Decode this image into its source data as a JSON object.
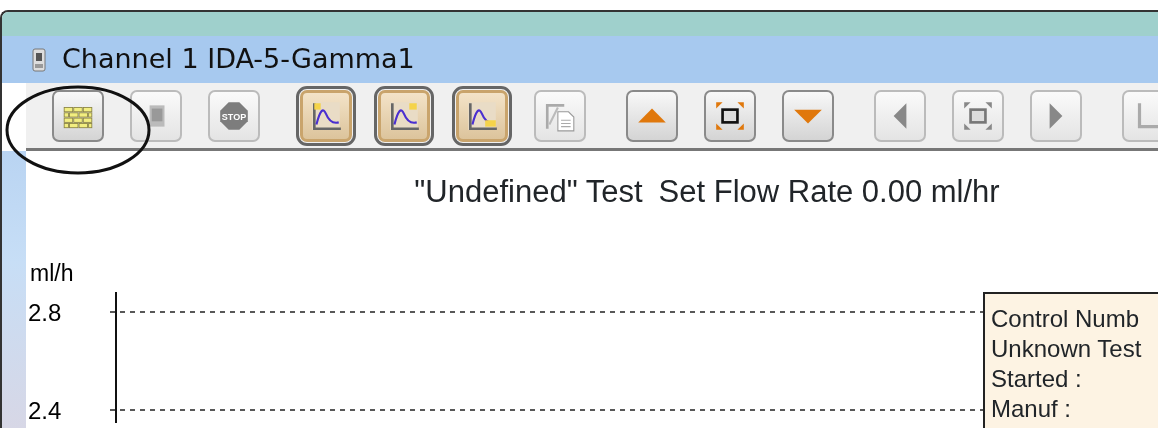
{
  "window": {
    "title": "Channel 1 IDA-5-Gamma1"
  },
  "toolbar": [
    {
      "buttons": [
        {
          "kind": "wall",
          "selected": false,
          "disabled": false
        },
        {
          "kind": "blank",
          "selected": false,
          "disabled": true
        },
        {
          "kind": "stop",
          "label": "STOP",
          "selected": false,
          "disabled": true
        }
      ]
    },
    {
      "buttons": [
        {
          "kind": "curve-left",
          "selected": true,
          "disabled": false
        },
        {
          "kind": "curve-right",
          "selected": true,
          "disabled": false
        },
        {
          "kind": "curve-bottom",
          "selected": true,
          "disabled": false
        },
        {
          "kind": "document",
          "selected": false,
          "disabled": true
        }
      ]
    },
    {
      "buttons": [
        {
          "kind": "up",
          "selected": false,
          "disabled": false
        },
        {
          "kind": "fit",
          "selected": false,
          "disabled": false
        },
        {
          "kind": "down",
          "selected": false,
          "disabled": false
        }
      ]
    },
    {
      "buttons": [
        {
          "kind": "left",
          "selected": false,
          "disabled": true
        },
        {
          "kind": "fit",
          "selected": false,
          "disabled": true
        },
        {
          "kind": "right",
          "selected": false,
          "disabled": true
        }
      ]
    },
    {
      "buttons": [
        {
          "kind": "partial",
          "selected": false,
          "disabled": true
        }
      ]
    }
  ],
  "chart": {
    "header": [
      "\"Undefined\" Test",
      "Set Flow Rate 0.00 ml/hr"
    ],
    "y_axis_label": "ml/h",
    "y_ticks": [
      "2.8",
      "2.4"
    ],
    "info_box": [
      "Control Numb",
      "Unknown Test",
      "Started :",
      "Manuf :"
    ]
  }
}
